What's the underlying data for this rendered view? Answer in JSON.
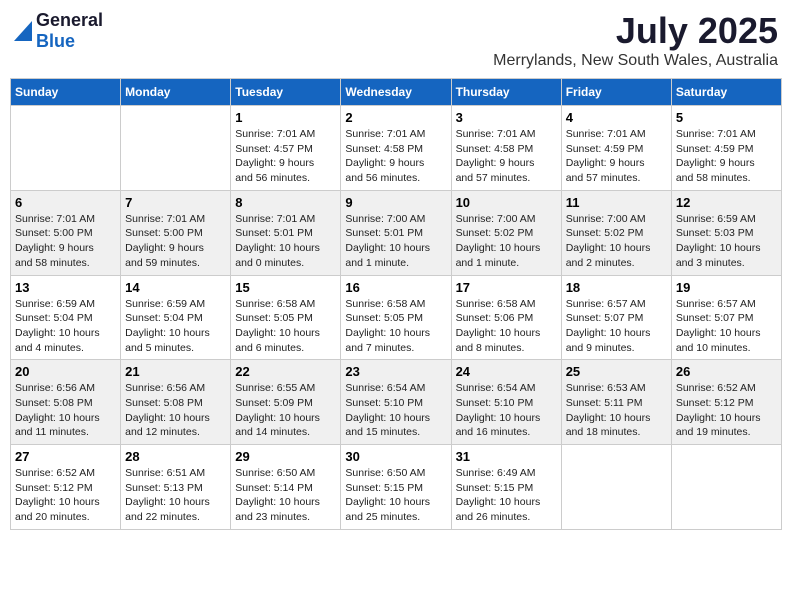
{
  "header": {
    "logo_general": "General",
    "logo_blue": "Blue",
    "month_title": "July 2025",
    "location": "Merrylands, New South Wales, Australia"
  },
  "days_of_week": [
    "Sunday",
    "Monday",
    "Tuesday",
    "Wednesday",
    "Thursday",
    "Friday",
    "Saturday"
  ],
  "weeks": [
    [
      {
        "day": "",
        "info": ""
      },
      {
        "day": "",
        "info": ""
      },
      {
        "day": "1",
        "info": "Sunrise: 7:01 AM\nSunset: 4:57 PM\nDaylight: 9 hours\nand 56 minutes."
      },
      {
        "day": "2",
        "info": "Sunrise: 7:01 AM\nSunset: 4:58 PM\nDaylight: 9 hours\nand 56 minutes."
      },
      {
        "day": "3",
        "info": "Sunrise: 7:01 AM\nSunset: 4:58 PM\nDaylight: 9 hours\nand 57 minutes."
      },
      {
        "day": "4",
        "info": "Sunrise: 7:01 AM\nSunset: 4:59 PM\nDaylight: 9 hours\nand 57 minutes."
      },
      {
        "day": "5",
        "info": "Sunrise: 7:01 AM\nSunset: 4:59 PM\nDaylight: 9 hours\nand 58 minutes."
      }
    ],
    [
      {
        "day": "6",
        "info": "Sunrise: 7:01 AM\nSunset: 5:00 PM\nDaylight: 9 hours\nand 58 minutes."
      },
      {
        "day": "7",
        "info": "Sunrise: 7:01 AM\nSunset: 5:00 PM\nDaylight: 9 hours\nand 59 minutes."
      },
      {
        "day": "8",
        "info": "Sunrise: 7:01 AM\nSunset: 5:01 PM\nDaylight: 10 hours\nand 0 minutes."
      },
      {
        "day": "9",
        "info": "Sunrise: 7:00 AM\nSunset: 5:01 PM\nDaylight: 10 hours\nand 1 minute."
      },
      {
        "day": "10",
        "info": "Sunrise: 7:00 AM\nSunset: 5:02 PM\nDaylight: 10 hours\nand 1 minute."
      },
      {
        "day": "11",
        "info": "Sunrise: 7:00 AM\nSunset: 5:02 PM\nDaylight: 10 hours\nand 2 minutes."
      },
      {
        "day": "12",
        "info": "Sunrise: 6:59 AM\nSunset: 5:03 PM\nDaylight: 10 hours\nand 3 minutes."
      }
    ],
    [
      {
        "day": "13",
        "info": "Sunrise: 6:59 AM\nSunset: 5:04 PM\nDaylight: 10 hours\nand 4 minutes."
      },
      {
        "day": "14",
        "info": "Sunrise: 6:59 AM\nSunset: 5:04 PM\nDaylight: 10 hours\nand 5 minutes."
      },
      {
        "day": "15",
        "info": "Sunrise: 6:58 AM\nSunset: 5:05 PM\nDaylight: 10 hours\nand 6 minutes."
      },
      {
        "day": "16",
        "info": "Sunrise: 6:58 AM\nSunset: 5:05 PM\nDaylight: 10 hours\nand 7 minutes."
      },
      {
        "day": "17",
        "info": "Sunrise: 6:58 AM\nSunset: 5:06 PM\nDaylight: 10 hours\nand 8 minutes."
      },
      {
        "day": "18",
        "info": "Sunrise: 6:57 AM\nSunset: 5:07 PM\nDaylight: 10 hours\nand 9 minutes."
      },
      {
        "day": "19",
        "info": "Sunrise: 6:57 AM\nSunset: 5:07 PM\nDaylight: 10 hours\nand 10 minutes."
      }
    ],
    [
      {
        "day": "20",
        "info": "Sunrise: 6:56 AM\nSunset: 5:08 PM\nDaylight: 10 hours\nand 11 minutes."
      },
      {
        "day": "21",
        "info": "Sunrise: 6:56 AM\nSunset: 5:08 PM\nDaylight: 10 hours\nand 12 minutes."
      },
      {
        "day": "22",
        "info": "Sunrise: 6:55 AM\nSunset: 5:09 PM\nDaylight: 10 hours\nand 14 minutes."
      },
      {
        "day": "23",
        "info": "Sunrise: 6:54 AM\nSunset: 5:10 PM\nDaylight: 10 hours\nand 15 minutes."
      },
      {
        "day": "24",
        "info": "Sunrise: 6:54 AM\nSunset: 5:10 PM\nDaylight: 10 hours\nand 16 minutes."
      },
      {
        "day": "25",
        "info": "Sunrise: 6:53 AM\nSunset: 5:11 PM\nDaylight: 10 hours\nand 18 minutes."
      },
      {
        "day": "26",
        "info": "Sunrise: 6:52 AM\nSunset: 5:12 PM\nDaylight: 10 hours\nand 19 minutes."
      }
    ],
    [
      {
        "day": "27",
        "info": "Sunrise: 6:52 AM\nSunset: 5:12 PM\nDaylight: 10 hours\nand 20 minutes."
      },
      {
        "day": "28",
        "info": "Sunrise: 6:51 AM\nSunset: 5:13 PM\nDaylight: 10 hours\nand 22 minutes."
      },
      {
        "day": "29",
        "info": "Sunrise: 6:50 AM\nSunset: 5:14 PM\nDaylight: 10 hours\nand 23 minutes."
      },
      {
        "day": "30",
        "info": "Sunrise: 6:50 AM\nSunset: 5:15 PM\nDaylight: 10 hours\nand 25 minutes."
      },
      {
        "day": "31",
        "info": "Sunrise: 6:49 AM\nSunset: 5:15 PM\nDaylight: 10 hours\nand 26 minutes."
      },
      {
        "day": "",
        "info": ""
      },
      {
        "day": "",
        "info": ""
      }
    ]
  ]
}
